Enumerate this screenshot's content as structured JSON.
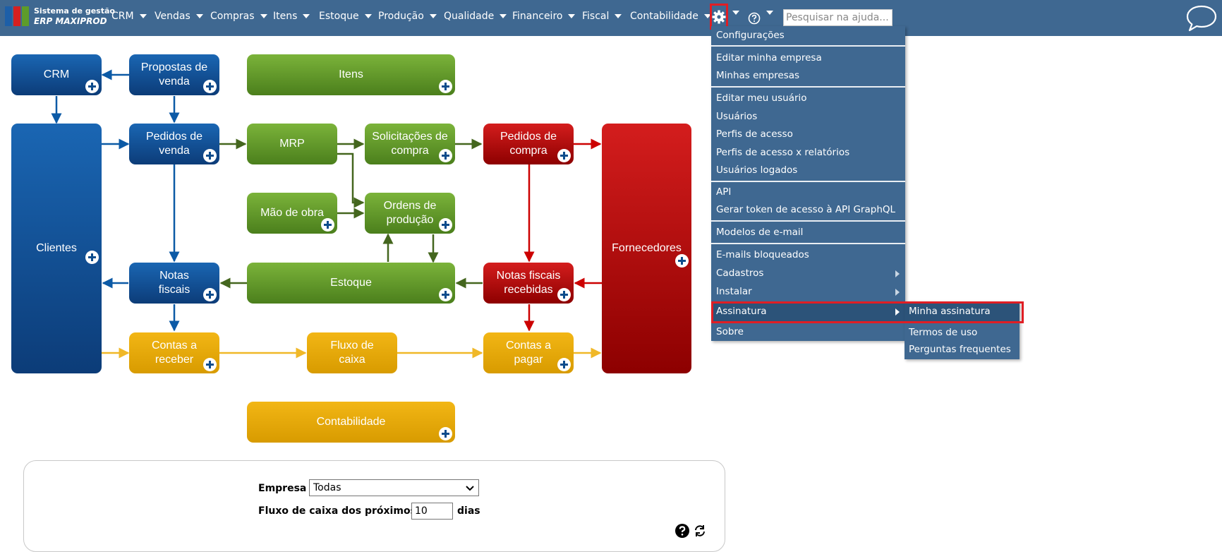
{
  "brand": {
    "line1": "Sistema de gestão",
    "line2": "ERP MAXIPROD"
  },
  "menu": [
    "CRM",
    "Vendas",
    "Compras",
    "Itens",
    "Estoque",
    "Produção",
    "Qualidade",
    "Financeiro",
    "Fiscal",
    "Contabilidade"
  ],
  "search": {
    "placeholder": "Pesquisar na ajuda..."
  },
  "diagram": {
    "crm": "CRM",
    "propostas": [
      "Propostas de",
      "venda"
    ],
    "itens": "Itens",
    "clientes": "Clientes",
    "pedidos_venda": [
      "Pedidos de",
      "venda"
    ],
    "mrp": "MRP",
    "solicitacoes": [
      "Solicitações de",
      "compra"
    ],
    "pedidos_compra": [
      "Pedidos de",
      "compra"
    ],
    "fornecedores": "Fornecedores",
    "mao_obra": "Mão de obra",
    "ordens": [
      "Ordens de",
      "produção"
    ],
    "notas_fiscais": [
      "Notas",
      "fiscais"
    ],
    "estoque": "Estoque",
    "notas_recebidas": [
      "Notas fiscais",
      "recebidas"
    ],
    "contas_receber": [
      "Contas a",
      "receber"
    ],
    "fluxo_caixa": [
      "Fluxo de",
      "caixa"
    ],
    "contas_pagar": [
      "Contas a",
      "pagar"
    ],
    "contabilidade": "Contabilidade"
  },
  "dropdown": {
    "items": [
      "Configurações",
      "Editar minha empresa",
      "Minhas empresas",
      "Editar meu usuário",
      "Usuários",
      "Perfis de acesso",
      "Perfis de acesso x relatórios",
      "Usuários logados",
      "API",
      "Gerar token de acesso à API GraphQL",
      "Modelos de e-mail",
      "E-mails bloqueados",
      "Cadastros",
      "Instalar",
      "Assinatura",
      "Sobre"
    ]
  },
  "submenu": {
    "items": [
      "Minha assinatura",
      "Termos de uso",
      "Perguntas frequentes"
    ]
  },
  "form": {
    "empresa_label": "Empresa",
    "empresa_value": "Todas",
    "fluxo_label": "Fluxo de caixa dos próximos",
    "dias_value": "10",
    "dias_label": "dias"
  },
  "colors": {
    "topbar": "#3f6891",
    "highlight": "#e01e24",
    "blue": "#0c4c8c",
    "green": "#5e9129",
    "red": "#b00000",
    "gold": "#e8a800"
  }
}
